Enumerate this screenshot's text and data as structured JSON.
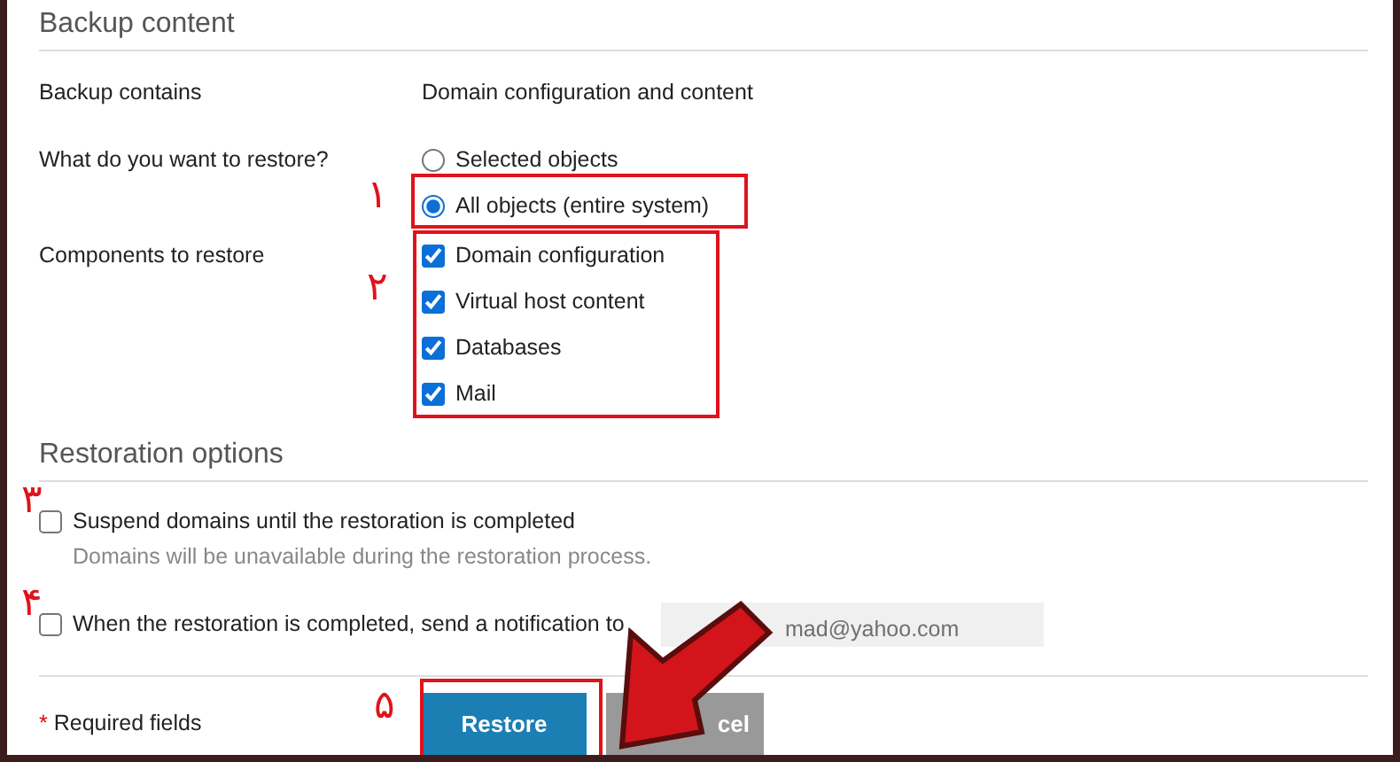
{
  "backup_section": {
    "heading": "Backup content",
    "rows": [
      {
        "label": "Backup contains",
        "value": "Domain configuration and content"
      }
    ],
    "restore_question": {
      "label": "What do you want to restore?",
      "options": [
        {
          "label": "Selected objects",
          "selected": false
        },
        {
          "label": "All objects (entire system)",
          "selected": true
        }
      ]
    },
    "components": {
      "label": "Components to restore",
      "items": [
        {
          "label": "Domain configuration",
          "checked": true
        },
        {
          "label": "Virtual host content",
          "checked": true
        },
        {
          "label": "Databases",
          "checked": true
        },
        {
          "label": "Mail",
          "checked": true
        }
      ]
    }
  },
  "restoration_section": {
    "heading": "Restoration options",
    "suspend": {
      "label": "Suspend domains until the restoration is completed",
      "checked": false,
      "hint": "Domains will be unavailable during the restoration process."
    },
    "notify": {
      "label": "When the restoration is completed, send a notification to",
      "checked": false,
      "email_value": "mad@yahoo.com"
    }
  },
  "footer": {
    "required_mark": "*",
    "required_text": "Required fields",
    "buttons": [
      {
        "label": "Restore",
        "kind": "primary"
      },
      {
        "label": "cel",
        "kind": "secondary"
      }
    ]
  },
  "annotation_numbers": [
    "۱",
    "۲",
    "۳",
    "۴",
    "۵"
  ]
}
